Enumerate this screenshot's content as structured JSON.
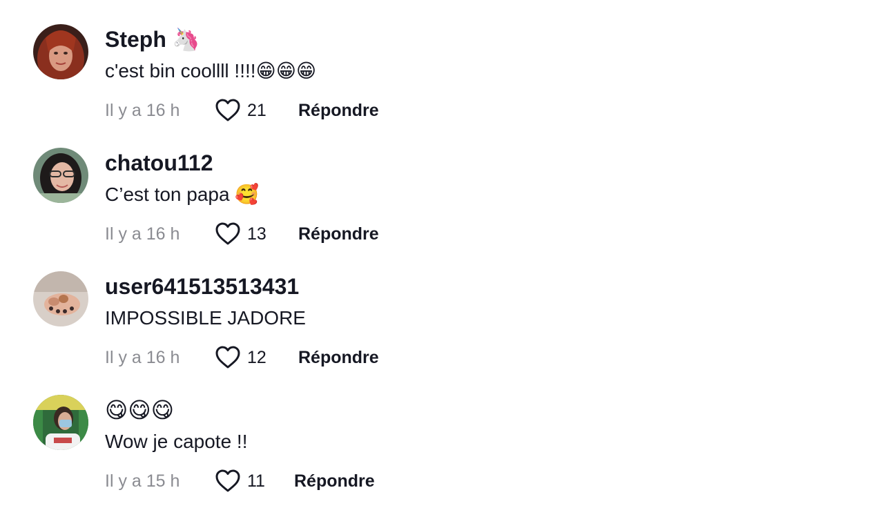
{
  "comments": [
    {
      "username": "Steph",
      "username_emoji": "🦄",
      "text": "c'est bin coollll !!!!😁😁😁",
      "timestamp": "Il y a 16 h",
      "likes": "21",
      "reply_label": "Répondre"
    },
    {
      "username": "chatou112",
      "username_emoji": "",
      "text": "C’est ton papa 🥰",
      "timestamp": "Il y a 16 h",
      "likes": "13",
      "reply_label": "Répondre"
    },
    {
      "username": "user641513513431",
      "username_emoji": "",
      "text": "IMPOSSIBLE JADORE",
      "timestamp": "Il y a 16 h",
      "likes": "12",
      "reply_label": "Répondre"
    },
    {
      "username": "😋😋😋",
      "username_emoji": "",
      "text": "Wow je capote !!",
      "timestamp": "Il y a 15 h",
      "likes": "11",
      "reply_label": "Répondre"
    }
  ],
  "colors": {
    "text_primary": "#161823",
    "text_secondary": "#8a8b91",
    "background": "#ffffff"
  },
  "icons": {
    "like": "heart-outline-icon"
  }
}
